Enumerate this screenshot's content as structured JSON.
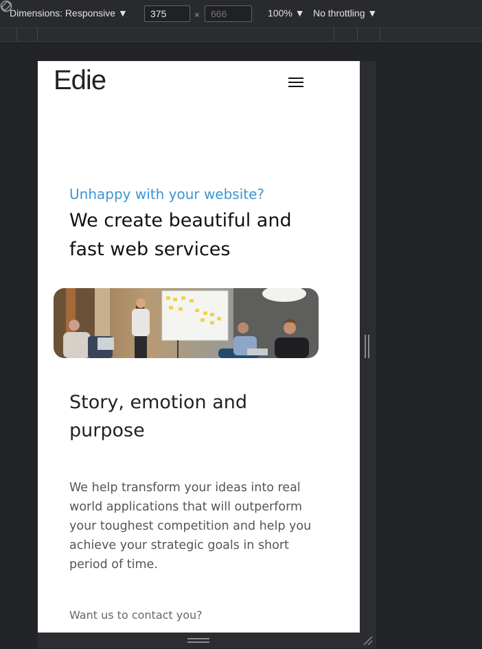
{
  "devtools": {
    "dimensions_label": "Dimensions: Responsive ▼",
    "width_value": "375",
    "height_placeholder": "666",
    "times_sign": "×",
    "zoom_label": "100% ▼",
    "throttling_label": "No throttling ▼",
    "rotate_icon": "rotate-icon"
  },
  "site": {
    "logo": "Edie",
    "menu_icon": "hamburger-menu-icon",
    "hero": {
      "subtitle": "Unhappy with your website?",
      "headline": "We create beautiful and fast web services"
    },
    "image_alt": "team-meeting-photo",
    "section": {
      "title": "Story, emotion and purpose",
      "body": "We help transform your ideas into real world applications that will outperform your toughest competition and help you achieve your strategic goals in short period of time."
    },
    "contact_link": "Want us to contact you?"
  },
  "colors": {
    "accent": "#3b95d3",
    "devtools_bg": "#232427",
    "toolbar_bg": "#292a2d"
  }
}
